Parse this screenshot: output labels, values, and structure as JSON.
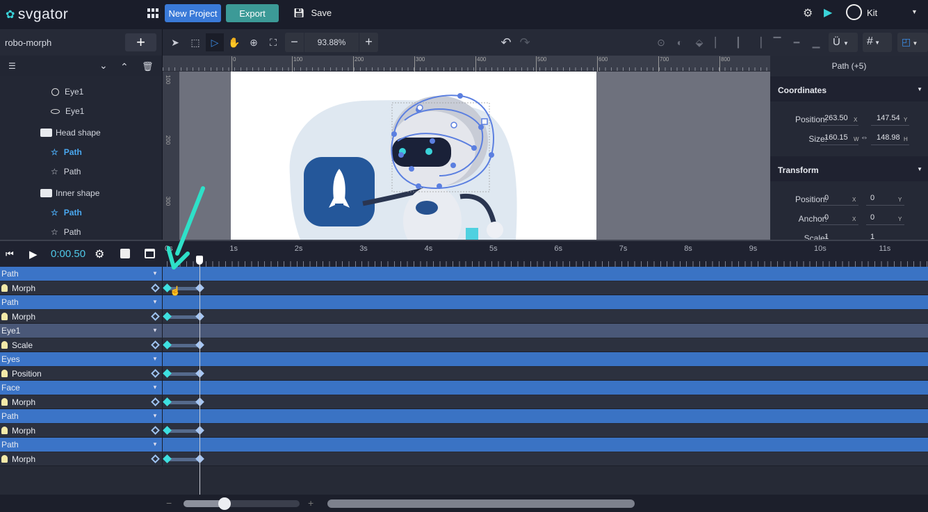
{
  "app": {
    "logo": "svgator",
    "brand_color": "#3ad3d9"
  },
  "topbar": {
    "new_project": "New Project",
    "export": "Export",
    "save": "Save",
    "user": "Kit",
    "icons": [
      "apps-grid-icon",
      "save-icon",
      "settings-icon",
      "play-icon",
      "user-icon",
      "chevron-down-icon"
    ]
  },
  "project": {
    "name": "robo-morph"
  },
  "toolbar": {
    "zoom": "93.88%"
  },
  "layers": [
    {
      "label": "Eye1",
      "icon": "circle-icon",
      "selected": false
    },
    {
      "label": "Eye1",
      "icon": "ellipse-icon",
      "selected": false
    },
    {
      "label": "Head shape",
      "icon": "folder-icon",
      "selected": false
    },
    {
      "label": "Path",
      "icon": "star-path-icon",
      "selected": true
    },
    {
      "label": "Path",
      "icon": "star-path-icon",
      "selected": false
    },
    {
      "label": "Inner shape",
      "icon": "folder-icon",
      "selected": false
    },
    {
      "label": "Path",
      "icon": "star-path-icon",
      "selected": true
    },
    {
      "label": "Path",
      "icon": "star-path-icon",
      "selected": false
    }
  ],
  "ruler": {
    "top": [
      "0",
      "100",
      "200",
      "300",
      "400",
      "500",
      "600",
      "700",
      "800"
    ],
    "left": [
      "100",
      "200",
      "300"
    ]
  },
  "inspector": {
    "title": "Path (+5)",
    "coordinates": {
      "title": "Coordinates",
      "position_label": "Position:",
      "pos_x": "263.50",
      "pos_y": "147.54",
      "size_label": "Size:",
      "w": "160.15",
      "h": "148.98",
      "x": "X",
      "y": "Y",
      "wu": "W",
      "hu": "H"
    },
    "transform": {
      "title": "Transform",
      "position_label": "Position:",
      "pos_x": "0",
      "pos_y": "0",
      "anchor_label": "Anchor:",
      "anc_x": "0",
      "anc_y": "0",
      "scale_label": "Scale:",
      "sc_x": "1",
      "sc_y": "1"
    }
  },
  "timeline": {
    "time": "0:00.50",
    "ticks": [
      "0s",
      "1s",
      "2s",
      "3s",
      "4s",
      "5s",
      "6s",
      "7s",
      "8s",
      "9s",
      "10s",
      "11s"
    ],
    "playhead_seconds": 0.5,
    "rows": [
      {
        "type": "group",
        "label": "Path"
      },
      {
        "type": "prop",
        "label": "Morph",
        "keyframes": [
          0,
          0.5
        ]
      },
      {
        "type": "group",
        "label": "Path"
      },
      {
        "type": "prop",
        "label": "Morph",
        "keyframes": [
          0,
          0.5
        ]
      },
      {
        "type": "group",
        "label": "Eye1",
        "alt": true
      },
      {
        "type": "prop",
        "label": "Scale",
        "keyframes": [
          0,
          0.5
        ]
      },
      {
        "type": "group",
        "label": "Eyes"
      },
      {
        "type": "prop",
        "label": "Position",
        "keyframes": [
          0,
          0.5
        ]
      },
      {
        "type": "group",
        "label": "Face"
      },
      {
        "type": "prop",
        "label": "Morph",
        "keyframes": [
          0,
          0.5
        ]
      },
      {
        "type": "group",
        "label": "Path"
      },
      {
        "type": "prop",
        "label": "Morph",
        "keyframes": [
          0,
          0.5
        ]
      },
      {
        "type": "group",
        "label": "Path"
      },
      {
        "type": "prop",
        "label": "Morph",
        "keyframes": [
          0,
          0.5
        ]
      }
    ]
  },
  "bottom": {
    "minus": "−",
    "plus": "+"
  }
}
